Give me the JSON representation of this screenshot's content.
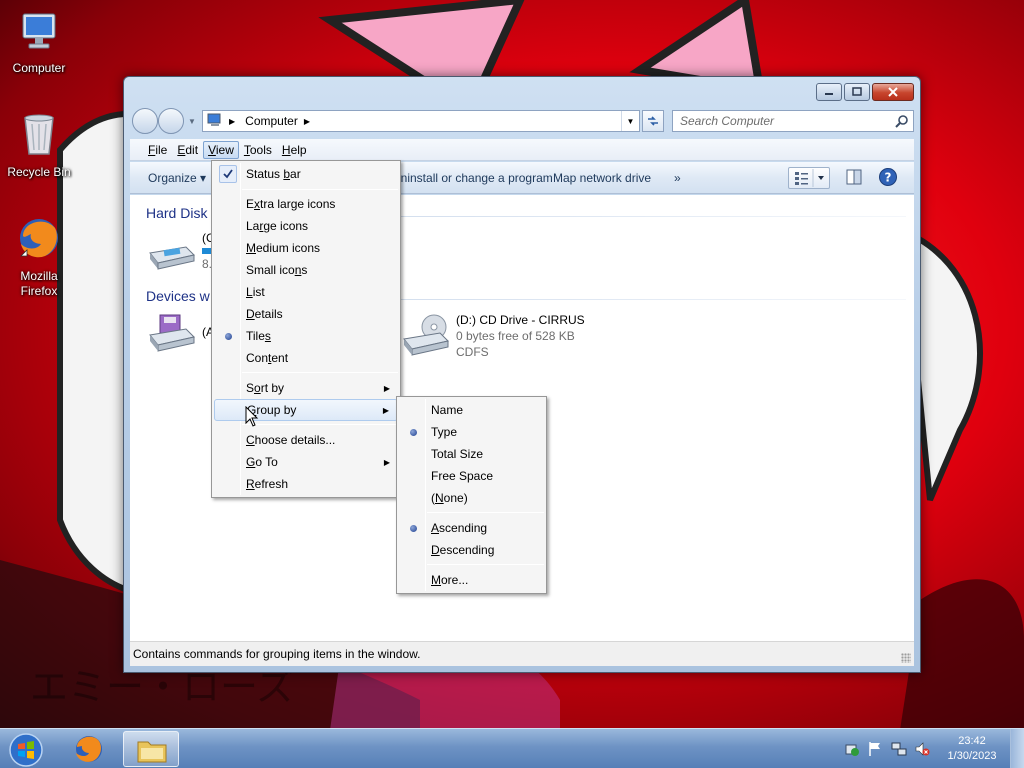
{
  "desktop": {
    "icons": [
      {
        "label": "Computer",
        "icon": "computer-icon"
      },
      {
        "label": "Recycle Bin",
        "icon": "recycle-bin-icon"
      },
      {
        "label": "Mozilla Firefox",
        "icon": "firefox-icon"
      }
    ]
  },
  "window": {
    "address": {
      "segment": "Computer"
    },
    "search": {
      "placeholder": "Search Computer"
    },
    "menubar": [
      "File",
      "Edit",
      "View",
      "Tools",
      "Help"
    ],
    "active_menu": "View",
    "toolbar": {
      "organize": "Organize",
      "uninstall": "Uninstall or change a program",
      "map_drive": "Map network drive",
      "more": "»"
    },
    "content": {
      "groups": [
        {
          "header": "Hard Disk Drives (1)",
          "visible_header": "Hard Disk"
        },
        {
          "header": "Devices with Removable Storage",
          "visible_header": "Devices w"
        }
      ],
      "hard_disk_tile": {
        "t1": "(C",
        "t2": "8."
      },
      "floppy_tile": {
        "t1": "(A"
      },
      "cd_tile": {
        "name": "(D:) CD Drive - CIRRUS",
        "free": "0 bytes free of 528 KB",
        "fs": "CDFS"
      }
    },
    "statusbar": "Contains commands for grouping items in the window."
  },
  "view_menu": {
    "items": [
      {
        "label": "Status bar",
        "accel": "b",
        "pre": "Status ",
        "post": "ar",
        "checked": true
      },
      {
        "label": "Extra large icons",
        "accel": "x",
        "pre": "E",
        "post": "tra large icons"
      },
      {
        "label": "Large icons",
        "accel": "r",
        "pre": "La",
        "post": "ge icons"
      },
      {
        "label": "Medium icons",
        "accel": "M",
        "pre": "",
        "post": "edium icons"
      },
      {
        "label": "Small icons",
        "accel": "n",
        "pre": "Small ico",
        "post": "s"
      },
      {
        "label": "List",
        "accel": "L",
        "pre": "",
        "post": "ist"
      },
      {
        "label": "Details",
        "accel": "D",
        "pre": "",
        "post": "etails"
      },
      {
        "label": "Tiles",
        "accel": "s",
        "pre": "Tile",
        "post": "",
        "selected": true
      },
      {
        "label": "Content",
        "accel": "t",
        "pre": "Con",
        "post": "ent"
      },
      {
        "label": "Sort by",
        "accel": "o",
        "pre": "S",
        "post": "rt by",
        "submenu": true
      },
      {
        "label": "Group by",
        "accel": "G",
        "pre": "",
        "post": "roup by",
        "submenu": true,
        "highlighted": true
      },
      {
        "label": "Choose details...",
        "accel": "C",
        "pre": "",
        "post": "hoose details..."
      },
      {
        "label": "Go To",
        "accel": "G",
        "pre": "",
        "post": "o To",
        "submenu": true
      },
      {
        "label": "Refresh",
        "accel": "R",
        "pre": "",
        "post": "efresh"
      }
    ]
  },
  "group_by_menu": {
    "items": [
      {
        "label": "Name"
      },
      {
        "label": "Type",
        "selected": true
      },
      {
        "label": "Total Size"
      },
      {
        "label": "Free Space"
      },
      {
        "label": "(None)",
        "pre": "(",
        "accel": "N",
        "post": "one)"
      },
      {
        "label": "Ascending",
        "pre": "",
        "accel": "A",
        "post": "scending",
        "selected": true
      },
      {
        "label": "Descending",
        "pre": "",
        "accel": "D",
        "post": "escending"
      },
      {
        "label": "More...",
        "pre": "",
        "accel": "M",
        "post": "ore..."
      }
    ]
  },
  "taskbar": {
    "clock_time": "23:42",
    "clock_date": "1/30/2023"
  },
  "colors": {
    "wallpaper_red": "#e0000e",
    "menu_highlight": "#dde9f8",
    "group_header": "#1e3287",
    "taskbar": "#6e93c4"
  }
}
